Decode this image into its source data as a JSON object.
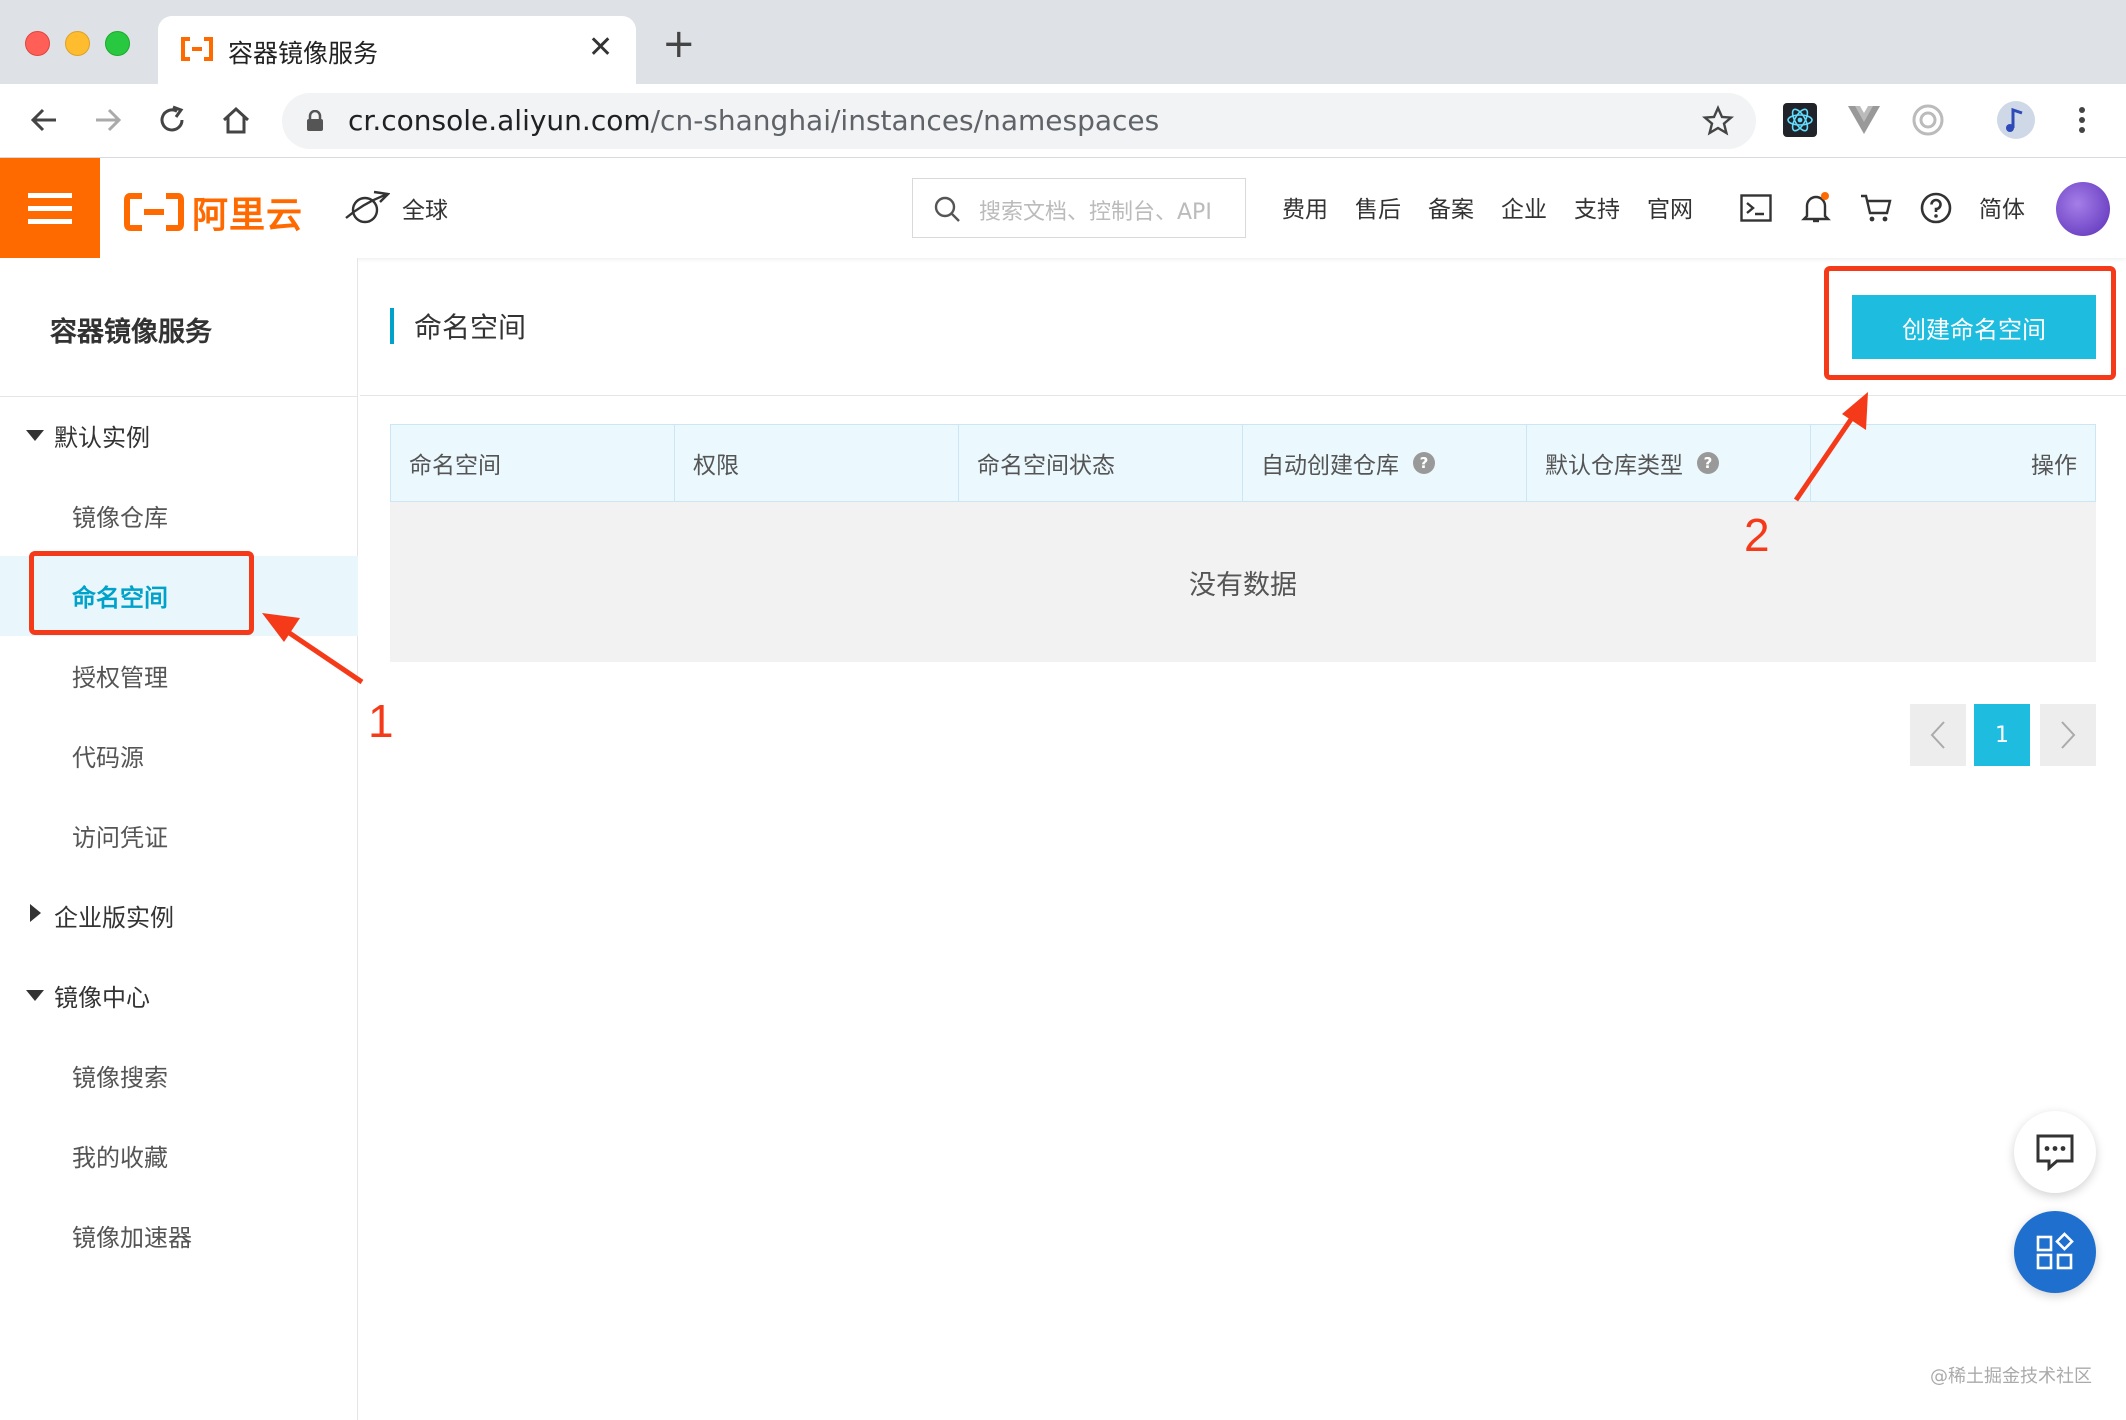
{
  "browser": {
    "tab_title": "容器镜像服务",
    "url_host": "cr.console.aliyun.com",
    "url_path": "/cn-shanghai/instances/namespaces"
  },
  "header": {
    "logo_text": "阿里云",
    "region_label": "全球",
    "search_placeholder": "搜索文档、控制台、API",
    "links": [
      "费用",
      "售后",
      "备案",
      "企业",
      "支持",
      "官网"
    ],
    "language": "简体",
    "brand_color": "#ff6a00"
  },
  "sidebar": {
    "title": "容器镜像服务",
    "items": [
      {
        "label": "默认实例",
        "type": "group",
        "expanded": true
      },
      {
        "label": "镜像仓库",
        "type": "sub"
      },
      {
        "label": "命名空间",
        "type": "sub",
        "active": true
      },
      {
        "label": "授权管理",
        "type": "sub"
      },
      {
        "label": "代码源",
        "type": "sub"
      },
      {
        "label": "访问凭证",
        "type": "sub"
      },
      {
        "label": "企业版实例",
        "type": "group",
        "expanded": false
      },
      {
        "label": "镜像中心",
        "type": "group",
        "expanded": true
      },
      {
        "label": "镜像搜索",
        "type": "sub"
      },
      {
        "label": "我的收藏",
        "type": "sub"
      },
      {
        "label": "镜像加速器",
        "type": "sub"
      }
    ]
  },
  "main": {
    "page_title": "命名空间",
    "create_button": "创建命名空间",
    "table": {
      "columns": [
        "命名空间",
        "权限",
        "命名空间状态",
        "自动创建仓库",
        "默认仓库类型",
        "操作"
      ],
      "empty_text": "没有数据"
    },
    "pagination": {
      "current_page": "1"
    },
    "accent_color": "#1ebde0"
  },
  "annotations": {
    "step1": "1",
    "step2": "2",
    "color": "#f53a1a"
  },
  "watermark": "@稀土掘金技术社区"
}
